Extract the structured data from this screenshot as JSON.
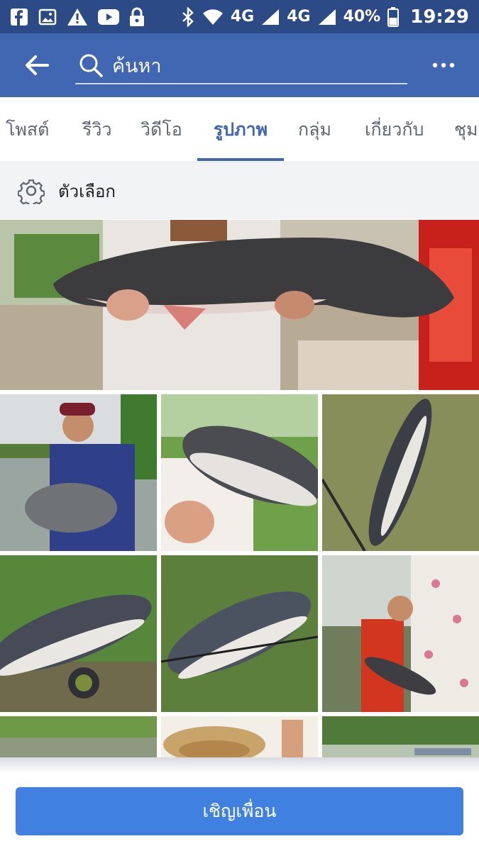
{
  "status_bar": {
    "network_1": "4G",
    "network_2": "4G",
    "battery": "40%",
    "time": "19:29",
    "icons": [
      "facebook-icon",
      "gallery-icon",
      "warning-icon",
      "youtube-icon",
      "lock-icon",
      "bluetooth-icon",
      "wifi-icon",
      "signal-icon",
      "battery-icon"
    ]
  },
  "app_bar": {
    "search_placeholder": "ค้นหา",
    "color": "#4267b2"
  },
  "tabs": [
    {
      "label": "โพสต์"
    },
    {
      "label": "รีวิว"
    },
    {
      "label": "วิดีโอ"
    },
    {
      "label": "รูปภาพ",
      "active": true
    },
    {
      "label": "กลุ่ม"
    },
    {
      "label": "เกี่ยวกับ"
    },
    {
      "label": "ชุม"
    }
  ],
  "options": {
    "label": "ตัวเลือก"
  },
  "photos": {
    "featured": "fish-held-by-man",
    "grid": [
      "man-holding-fish-lakeside",
      "fish-closeup-held",
      "fish-on-grass",
      "fish-with-reel-on-grass",
      "fish-on-grass-rod",
      "man-with-fish-by-pond",
      "lake-view",
      "straw-hat-person",
      "trees-view"
    ]
  },
  "invite_button": {
    "label": "เชิญเพื่อน",
    "color": "#4080e0"
  }
}
